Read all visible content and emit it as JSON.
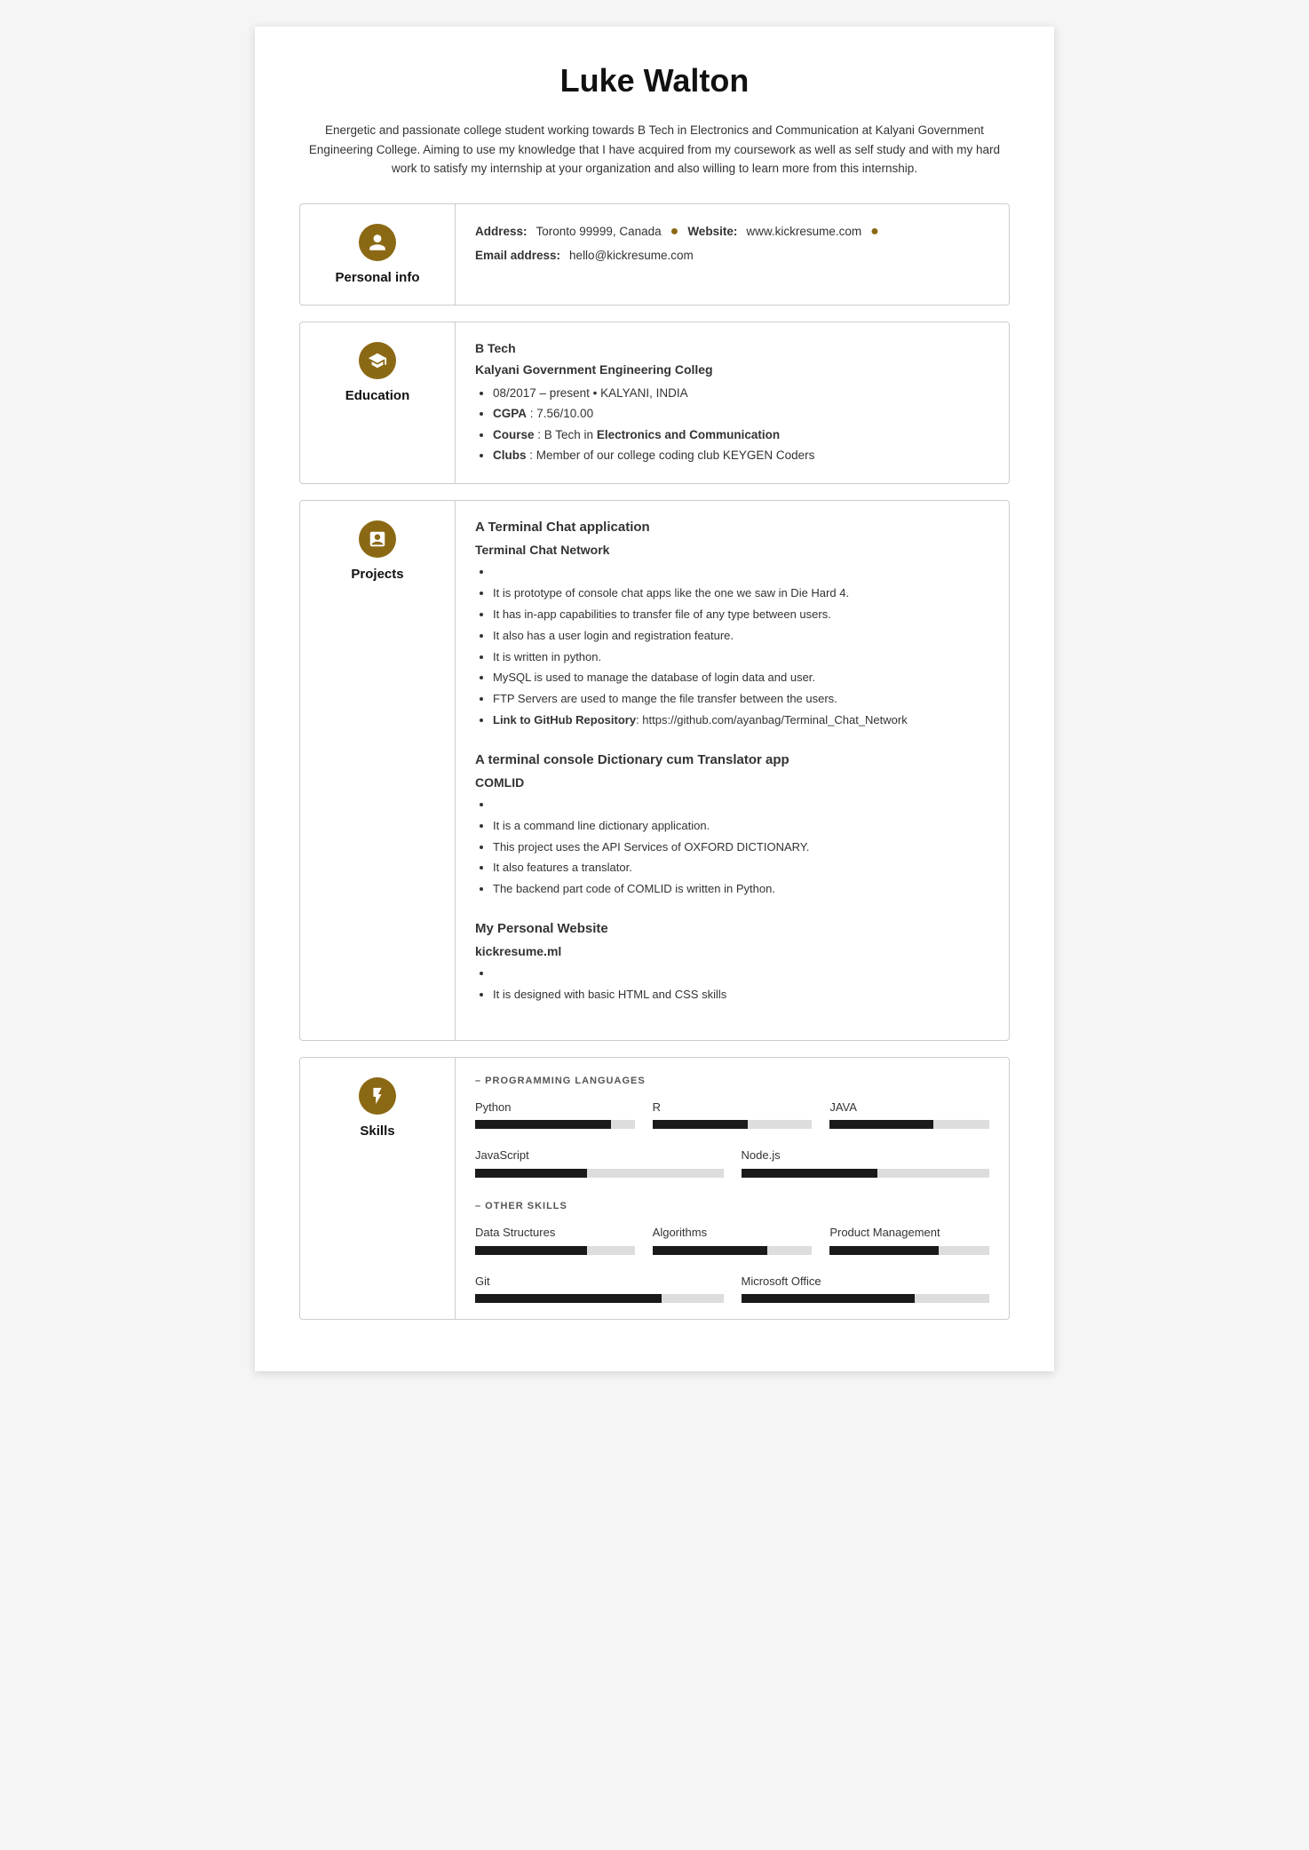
{
  "resume": {
    "name": "Luke Walton",
    "summary": "Energetic and passionate college student working towards B Tech in Electronics and Communication at Kalyani Government Engineering College. Aiming to use my knowledge that I have acquired from my coursework as well as self study and with my hard work to satisfy my internship at your organization and also willing to learn more from this internship.",
    "sections": {
      "personal_info": {
        "title": "Personal info",
        "icon": "👤",
        "address_label": "Address:",
        "address_value": "Toronto 99999, Canada",
        "website_label": "Website:",
        "website_value": "www.kickresume.com",
        "email_label": "Email address:",
        "email_value": "hello@kickresume.com"
      },
      "education": {
        "title": "Education",
        "icon": "🎓",
        "degree": "B Tech",
        "school": "Kalyani Government Engineering Colleg",
        "details": [
          "08/2017 – present • KALYANI, INDIA",
          "CGPA : 7.56/10.00",
          "Course : B Tech in Electronics and Communication",
          "Clubs : Member of our college coding club KEYGEN Coders"
        ]
      },
      "projects": {
        "title": "Projects",
        "icon": "📋",
        "items": [
          {
            "title": "A Terminal Chat application",
            "subtitle": "Terminal Chat Network",
            "bullets": [
              "",
              "It is prototype of console chat apps like the one we saw in Die Hard 4.",
              "It has in-app capabilities to transfer file of any type between users.",
              "It also has a user login and registration feature.",
              "It is written in python.",
              "MySQL is used to manage the database of login data and user.",
              "FTP Servers are used to mange the file transfer between the users.",
              "Link to GitHub Repository: https://github.com/ayanbag/Terminal_Chat_Network"
            ]
          },
          {
            "title": "A terminal console Dictionary cum Translator app",
            "subtitle": "COMLID",
            "bullets": [
              "",
              "It is a command line dictionary application.",
              "This project uses the API Services of OXFORD DICTIONARY.",
              "It also features a translator.",
              "The backend part code of COMLID is written in Python."
            ]
          },
          {
            "title": "My Personal Website",
            "subtitle": "kickresume.ml",
            "bullets": [
              "",
              "It is designed with basic HTML and CSS skills"
            ]
          }
        ]
      },
      "skills": {
        "title": "Skills",
        "icon": "🔬",
        "programming_label": "– PROGRAMMING LANGUAGES",
        "programming": [
          {
            "name": "Python",
            "pct": 85
          },
          {
            "name": "R",
            "pct": 60
          },
          {
            "name": "JAVA",
            "pct": 65
          },
          {
            "name": "JavaScript",
            "pct": 45
          },
          {
            "name": "Node.js",
            "pct": 55
          }
        ],
        "other_label": "– OTHER SKILLS",
        "other": [
          {
            "name": "Data Structures",
            "pct": 70
          },
          {
            "name": "Algorithms",
            "pct": 72
          },
          {
            "name": "Product Management",
            "pct": 68
          },
          {
            "name": "Git",
            "pct": 75
          },
          {
            "name": "Microsoft Office",
            "pct": 70
          }
        ]
      }
    }
  }
}
